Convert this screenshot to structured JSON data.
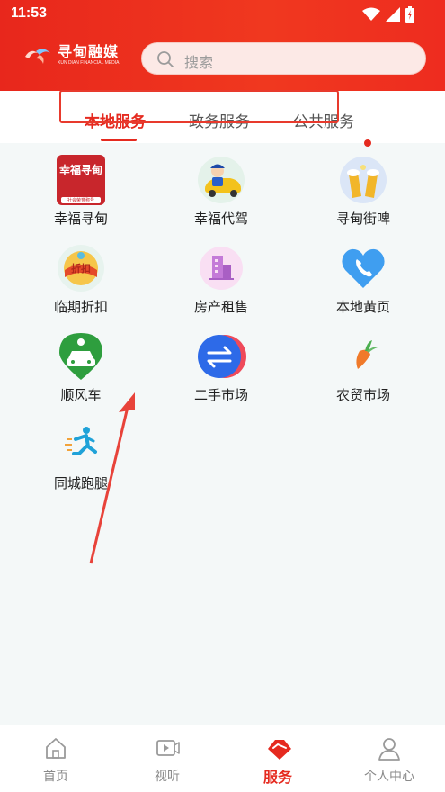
{
  "status_bar": {
    "time": "11:53",
    "icons": [
      "wifi-icon",
      "signal-icon",
      "battery-icon"
    ]
  },
  "header": {
    "logo_name": "寻甸融媒",
    "logo_subtitle": "XUN DIAN FINANCIAL MEDIA",
    "search_placeholder": "搜索"
  },
  "tabs": [
    {
      "label": "本地服务",
      "active": true
    },
    {
      "label": "政务服务",
      "active": false
    },
    {
      "label": "公共服务",
      "active": false
    }
  ],
  "services": [
    {
      "label": "幸福寻甸",
      "icon": "xingfu-xundian-icon",
      "badge_text": "幸福寻甸",
      "badge_sub": "社会荣誉称号"
    },
    {
      "label": "幸福代驾",
      "icon": "driver-car-icon"
    },
    {
      "label": "寻甸街啤",
      "icon": "beer-icon"
    },
    {
      "label": "临期折扣",
      "icon": "discount-icon",
      "badge_text": "折扣"
    },
    {
      "label": "房产租售",
      "icon": "building-icon"
    },
    {
      "label": "本地黄页",
      "icon": "phone-icon"
    },
    {
      "label": "顺风车",
      "icon": "carpool-icon"
    },
    {
      "label": "二手市场",
      "icon": "exchange-icon"
    },
    {
      "label": "农贸市场",
      "icon": "carrot-icon"
    },
    {
      "label": "同城跑腿",
      "icon": "runner-icon"
    }
  ],
  "bottom_nav": [
    {
      "label": "首页",
      "icon": "home-icon",
      "active": false
    },
    {
      "label": "视听",
      "icon": "video-icon",
      "active": false
    },
    {
      "label": "服务",
      "icon": "service-icon",
      "active": true
    },
    {
      "label": "个人中心",
      "icon": "user-icon",
      "active": false
    }
  ],
  "colors": {
    "brand_red": "#e52a1f",
    "background": "#f4f8f8"
  }
}
